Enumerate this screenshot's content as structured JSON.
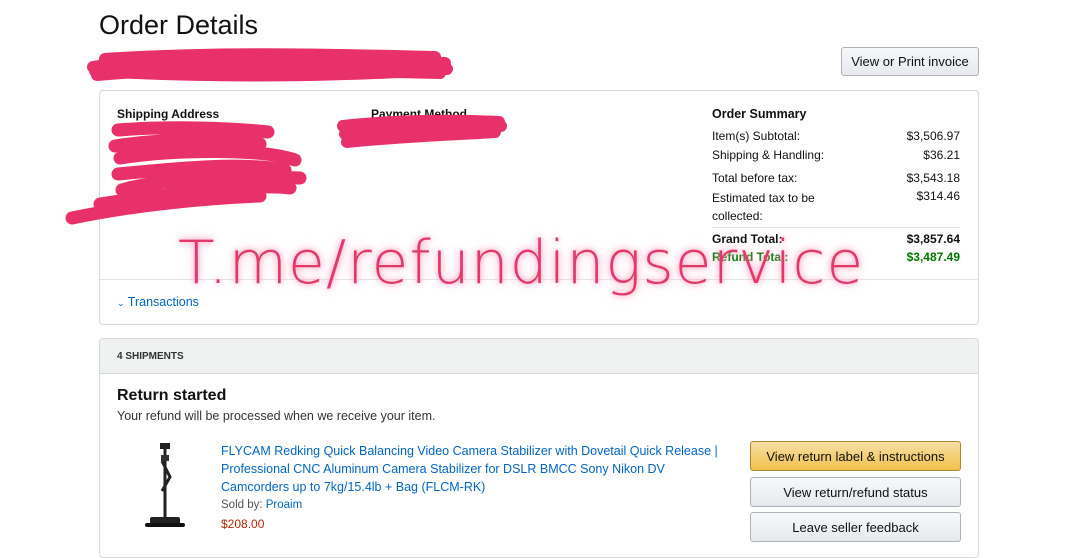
{
  "page": {
    "title": "Order Details",
    "invoice_button": "View or Print invoice"
  },
  "details": {
    "shipping_address_label": "Shipping Address",
    "payment_method_label": "Payment Method",
    "summary": {
      "title": "Order Summary",
      "rows": [
        {
          "label": "Item(s) Subtotal:",
          "value": "$3,506.97"
        },
        {
          "label": "Shipping & Handling:",
          "value": "$36.21"
        },
        {
          "label": "Total before tax:",
          "value": "$3,543.18"
        },
        {
          "label": "Estimated tax to be collected:",
          "value": "$314.46"
        }
      ],
      "grand_total_label": "Grand Total:",
      "grand_total_value": "$3,857.64",
      "refund_total_label": "Refund Total:",
      "refund_total_value": "$3,487.49"
    },
    "transactions_link": "Transactions"
  },
  "watermark": "T.me/refundingservice",
  "shipments": {
    "header": "4 SHIPMENTS",
    "status_title": "Return started",
    "status_text": "Your refund will be processed when we receive your item.",
    "item": {
      "title": "FLYCAM Redking Quick Balancing Video Camera Stabilizer with Dovetail Quick Release | Professional CNC Aluminum Camera Stabilizer for DSLR BMCC Sony Nikon DV Camcorders up to 7kg/15.4lb + Bag (FLCM-RK)",
      "sold_by_label": "Sold by:",
      "seller": "Proaim",
      "price": "$208.00"
    },
    "actions": {
      "return_label": "View return label & instructions",
      "refund_status": "View return/refund status",
      "seller_feedback": "Leave seller feedback"
    }
  },
  "colors": {
    "accent_link": "#0066c0",
    "price": "#b12704",
    "refund_green": "#007600",
    "scribble": "#e8306a",
    "primary_button": "#f0c14b"
  }
}
